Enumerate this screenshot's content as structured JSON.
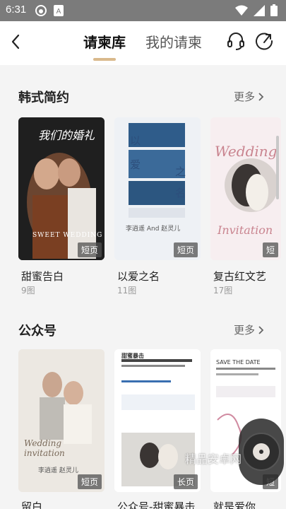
{
  "status_bar": {
    "time": "6:31"
  },
  "header": {
    "tabs": [
      {
        "label": "请柬库",
        "active": true
      },
      {
        "label": "我的请柬",
        "active": false
      }
    ]
  },
  "sections": [
    {
      "title": "韩式简约",
      "more_label": "更多",
      "cards": [
        {
          "title": "甜蜜告白",
          "count": "9图",
          "badge": "短页",
          "cover_text": "我们的婚礼",
          "cover_text2": "SWEET WEDDING"
        },
        {
          "title": "以爱之名",
          "count": "11图",
          "badge": "短页",
          "cover_chars": [
            "以",
            "爱",
            "之",
            "名"
          ],
          "names": "李逍遥  And  赵灵儿"
        },
        {
          "title": "复古红文艺",
          "count": "17图",
          "badge": "短",
          "cover_text": "Wedding",
          "cover_text2": "Invitation"
        }
      ]
    },
    {
      "title": "公众号",
      "more_label": "更多",
      "cards": [
        {
          "title": "留白",
          "badge": "短页",
          "cover_text": "Wedding invitation",
          "names": "李逍遥   赵灵儿"
        },
        {
          "title": "公众号-甜蜜暴击",
          "badge": "长页",
          "cover_text": "甜蜜暴击"
        },
        {
          "title": "就是爱你",
          "badge": "短",
          "cover_text": "SAVE THE DATE"
        }
      ]
    }
  ],
  "watermark": "精品安卓网",
  "colors": {
    "accent": "#d9b98c",
    "status_bar": "#7b7b7b"
  }
}
